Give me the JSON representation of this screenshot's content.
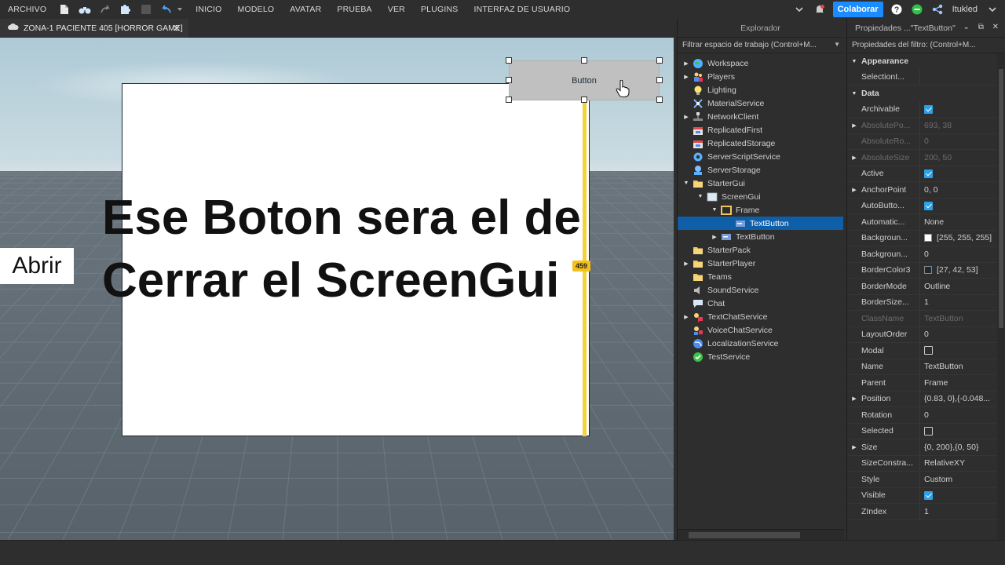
{
  "menu": {
    "archivo": "ARCHIVO",
    "items": [
      "INICIO",
      "MODELO",
      "AVATAR",
      "PRUEBA",
      "VER",
      "PLUGINS",
      "INTERFAZ DE USUARIO"
    ],
    "collaborate": "Colaborar",
    "user": "Itukled"
  },
  "tab": {
    "title": "ZONA-1 PACIENTE 405 [HORROR GAME]",
    "close": "✕"
  },
  "viewport": {
    "button_text": "Button",
    "overlay_line1": "Ese Boton sera el de",
    "overlay_line2": "Cerrar el ScreenGui",
    "abrir": "Abrir",
    "measure_badge": "459"
  },
  "explorer": {
    "title": "Explorador",
    "filter": "Filtrar espacio de trabajo (Control+M...",
    "items": [
      {
        "label": "Workspace",
        "icon": "globe-icon",
        "arrow": "▶"
      },
      {
        "label": "Players",
        "icon": "players-icon",
        "arrow": "▶"
      },
      {
        "label": "Lighting",
        "icon": "bulb-icon",
        "arrow": ""
      },
      {
        "label": "MaterialService",
        "icon": "material-icon",
        "arrow": ""
      },
      {
        "label": "NetworkClient",
        "icon": "network-icon",
        "arrow": "▶"
      },
      {
        "label": "ReplicatedFirst",
        "icon": "replicated-first-icon",
        "arrow": ""
      },
      {
        "label": "ReplicatedStorage",
        "icon": "replicated-storage-icon",
        "arrow": ""
      },
      {
        "label": "ServerScriptService",
        "icon": "script-service-icon",
        "arrow": ""
      },
      {
        "label": "ServerStorage",
        "icon": "server-storage-icon",
        "arrow": ""
      },
      {
        "label": "StarterGui",
        "icon": "folder-icon",
        "arrow": "▼"
      },
      {
        "label": "ScreenGui",
        "icon": "screen-icon",
        "arrow": "▼"
      },
      {
        "label": "Frame",
        "icon": "frame-icon",
        "arrow": "▼"
      },
      {
        "label": "TextButton",
        "icon": "textbutton-icon",
        "arrow": ""
      },
      {
        "label": "TextButton",
        "icon": "textbutton-icon",
        "arrow": "▶"
      },
      {
        "label": "StarterPack",
        "icon": "folder-icon",
        "arrow": ""
      },
      {
        "label": "StarterPlayer",
        "icon": "folder-icon",
        "arrow": "▶"
      },
      {
        "label": "Teams",
        "icon": "folder-icon",
        "arrow": ""
      },
      {
        "label": "SoundService",
        "icon": "sound-icon",
        "arrow": ""
      },
      {
        "label": "Chat",
        "icon": "chat-icon",
        "arrow": ""
      },
      {
        "label": "TextChatService",
        "icon": "textchat-icon",
        "arrow": "▶"
      },
      {
        "label": "VoiceChatService",
        "icon": "voicechat-icon",
        "arrow": ""
      },
      {
        "label": "LocalizationService",
        "icon": "localization-icon",
        "arrow": ""
      },
      {
        "label": "TestService",
        "icon": "check-icon",
        "arrow": ""
      }
    ]
  },
  "properties": {
    "title": "Propiedades ...\"TextButton\"",
    "filter": "Propiedades del filtro: (Control+M...",
    "rows": [
      {
        "type": "cat",
        "name": "Appearance",
        "exp": "▼"
      },
      {
        "type": "prop",
        "name": "SelectionI...",
        "value": ""
      },
      {
        "type": "cat",
        "name": "Data",
        "exp": "▼"
      },
      {
        "type": "prop",
        "name": "Archivable",
        "value": "",
        "check": "on"
      },
      {
        "type": "prop",
        "name": "AbsolutePo...",
        "value": "693, 38",
        "dim": true,
        "exp": "▶"
      },
      {
        "type": "prop",
        "name": "AbsoluteRo...",
        "value": "0",
        "dim": true
      },
      {
        "type": "prop",
        "name": "AbsoluteSize",
        "value": "200, 50",
        "dim": true,
        "exp": "▶"
      },
      {
        "type": "prop",
        "name": "Active",
        "value": "",
        "check": "on"
      },
      {
        "type": "prop",
        "name": "AnchorPoint",
        "value": "0, 0",
        "exp": "▶"
      },
      {
        "type": "prop",
        "name": "AutoButto...",
        "value": "",
        "check": "on"
      },
      {
        "type": "prop",
        "name": "Automatic...",
        "value": "None"
      },
      {
        "type": "prop",
        "name": "Backgroun...",
        "value": "[255, 255, 255]",
        "swatch": "#ffffff"
      },
      {
        "type": "prop",
        "name": "Backgroun...",
        "value": "0"
      },
      {
        "type": "prop",
        "name": "BorderColor3",
        "value": "[27, 42, 53]",
        "swatch": "#1b2a35"
      },
      {
        "type": "prop",
        "name": "BorderMode",
        "value": "Outline"
      },
      {
        "type": "prop",
        "name": "BorderSize...",
        "value": "1"
      },
      {
        "type": "prop",
        "name": "ClassName",
        "value": "TextButton",
        "dim": true
      },
      {
        "type": "prop",
        "name": "LayoutOrder",
        "value": "0"
      },
      {
        "type": "prop",
        "name": "Modal",
        "value": "",
        "check": "off"
      },
      {
        "type": "prop",
        "name": "Name",
        "value": "TextButton"
      },
      {
        "type": "prop",
        "name": "Parent",
        "value": "Frame"
      },
      {
        "type": "prop",
        "name": "Position",
        "value": "{0.83, 0},{-0.048...",
        "exp": "▶"
      },
      {
        "type": "prop",
        "name": "Rotation",
        "value": "0"
      },
      {
        "type": "prop",
        "name": "Selected",
        "value": "",
        "check": "off"
      },
      {
        "type": "prop",
        "name": "Size",
        "value": "{0, 200},{0, 50}",
        "exp": "▶"
      },
      {
        "type": "prop",
        "name": "SizeConstra...",
        "value": "RelativeXY"
      },
      {
        "type": "prop",
        "name": "Style",
        "value": "Custom"
      },
      {
        "type": "prop",
        "name": "Visible",
        "value": "",
        "check": "on"
      },
      {
        "type": "prop",
        "name": "ZIndex",
        "value": "1"
      }
    ]
  },
  "colors": {
    "accent": "#1a8cff",
    "selection": "#0f5fa8",
    "frame_border": "#1b2a35",
    "guide_yellow": "#f2d43a"
  }
}
